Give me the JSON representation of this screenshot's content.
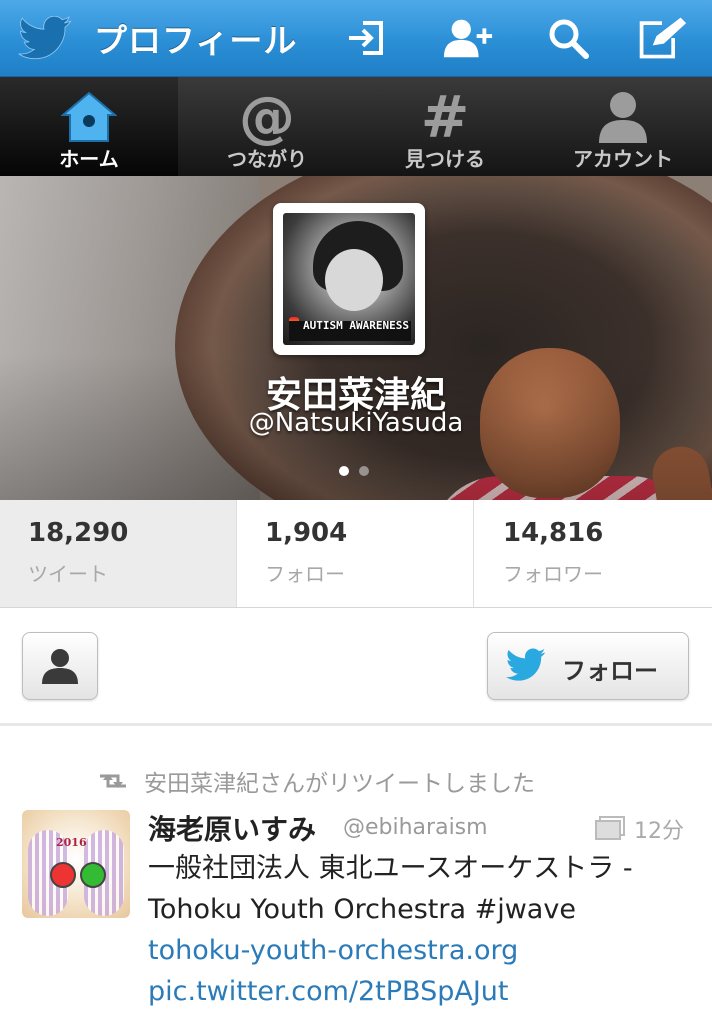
{
  "header": {
    "title": "プロフィール"
  },
  "tabs": [
    {
      "label": "ホーム",
      "icon": "home-icon",
      "active": true
    },
    {
      "label": "つながり",
      "icon": "at-icon",
      "active": false
    },
    {
      "label": "見つける",
      "icon": "hash-icon",
      "active": false
    },
    {
      "label": "アカウント",
      "icon": "person-icon",
      "active": false
    }
  ],
  "profile": {
    "name": "安田菜津紀",
    "handle": "@NatsukiYasuda",
    "avatar_badge": "AUTISM AWARENESS"
  },
  "stats": [
    {
      "value": "18,290",
      "label": "ツイート"
    },
    {
      "value": "1,904",
      "label": "フォロー"
    },
    {
      "value": "14,816",
      "label": "フォロワー"
    }
  ],
  "actions": {
    "follow_label": "フォロー"
  },
  "tweet": {
    "retweet_notice": "安田菜津紀さんがリツイートしました",
    "name": "海老原いすみ",
    "handle": "@ebiharaism",
    "time": "12分",
    "avatar_text": "2016",
    "text": "一般社団法人 東北ユースオーケストラ - Tohoku Youth Orchestra #jwave",
    "link1": "tohoku-youth-orchestra.org",
    "link2": "pic.twitter.com/2tPBSpAJut"
  },
  "colors": {
    "brand_blue": "#2b8fd6",
    "link": "#2b7bb9"
  }
}
